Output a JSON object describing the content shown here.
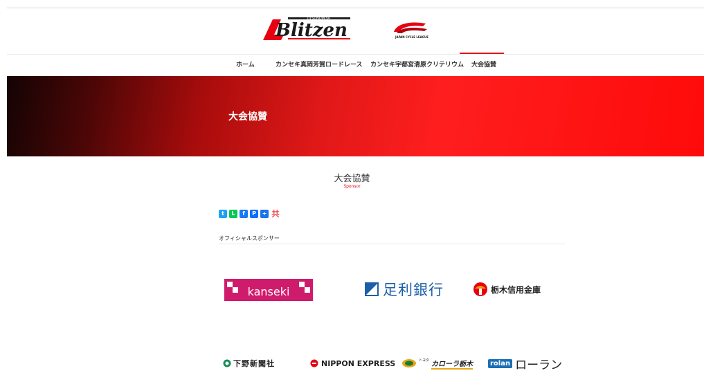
{
  "header": {
    "logo_blitzen_text": "Blitzen",
    "logo_blitzen_sub": "UTSUNOMIYA",
    "logo_jcl_text": "JAPAN CYCLE LEAGUE"
  },
  "nav": {
    "items": [
      {
        "label": "ホーム"
      },
      {
        "label": "カンセキ真岡芳賀ロードレース"
      },
      {
        "label": "カンセキ宇都宮清原クリテリウム"
      },
      {
        "label": "大会協賛"
      }
    ],
    "active_index": 3
  },
  "hero": {
    "title": "大会協賛"
  },
  "section": {
    "title": "大会協賛",
    "subtitle": "Sponsor"
  },
  "share": {
    "icons": [
      "twitter-icon",
      "line-icon",
      "facebook-icon",
      "pocket-icon",
      "addthis-icon"
    ],
    "label": "共"
  },
  "category": {
    "title": "オフィシャルスポンサー"
  },
  "sponsors": {
    "kanseki": "kanseki",
    "ashikaga": "足利銀行",
    "tochishin": "栃木信用金庫",
    "shimono": "下野新聞社",
    "nippon": "NIPPON EXPRESS",
    "corolla_small": "トヨタ",
    "corolla": "カローラ栃木",
    "rolan_box": "rolan",
    "rolan": "ローラン"
  },
  "colors": {
    "accent": "#e60012",
    "hero_dark": "#140404",
    "hero_bright": "#ff1e1e"
  }
}
